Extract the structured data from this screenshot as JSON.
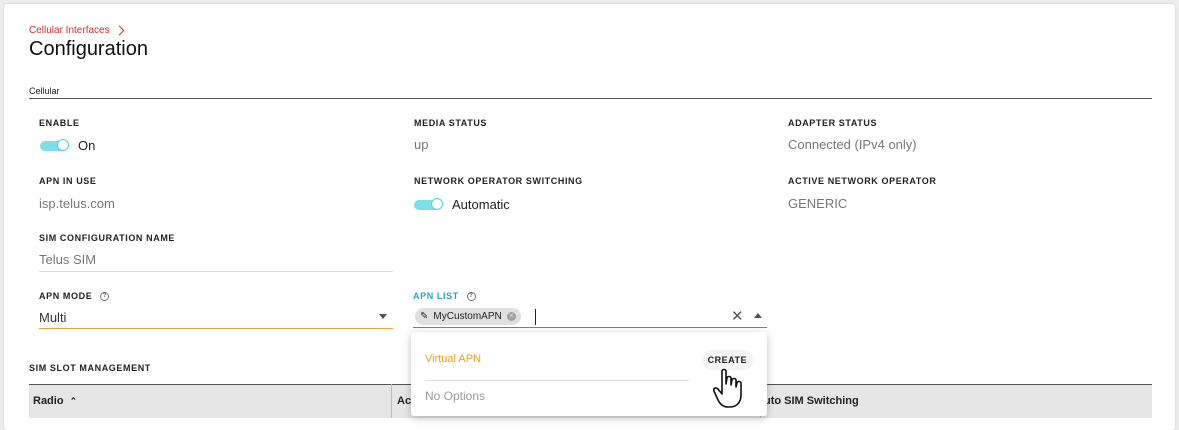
{
  "breadcrumb": {
    "parent": "Cellular Interfaces"
  },
  "page": {
    "title": "Configuration",
    "section": "Cellular"
  },
  "fields": {
    "enable": {
      "label": "ENABLE",
      "value": "On"
    },
    "media_status": {
      "label": "MEDIA STATUS",
      "value": "up"
    },
    "adapter_status": {
      "label": "ADAPTER STATUS",
      "value": "Connected (IPv4 only)"
    },
    "apn_in_use": {
      "label": "APN IN USE",
      "value": "isp.telus.com"
    },
    "operator_switching": {
      "label": "NETWORK OPERATOR SWITCHING",
      "value": "Automatic"
    },
    "active_operator": {
      "label": "ACTIVE NETWORK OPERATOR",
      "value": "GENERIC"
    },
    "sim_config_name": {
      "label": "SIM CONFIGURATION NAME",
      "value": "Telus SIM"
    },
    "apn_mode": {
      "label": "APN MODE",
      "value": "Multi"
    },
    "apn_list": {
      "label": "APN LIST",
      "chip": "MyCustomAPN"
    }
  },
  "dropdown": {
    "item": "Virtual APN",
    "create_label": "CREATE",
    "empty_text": "No Options"
  },
  "sim_slot": {
    "label": "SIM SLOT MANAGEMENT",
    "columns": [
      "Radio",
      "Ac",
      "uto SIM Switching"
    ]
  },
  "colors": {
    "breadcrumb": "#d32f2f",
    "toggle": "#80deea",
    "apn_list_label": "#26a5b8",
    "virtual_apn": "#f0a010",
    "select_underline": "#e8a04a"
  }
}
